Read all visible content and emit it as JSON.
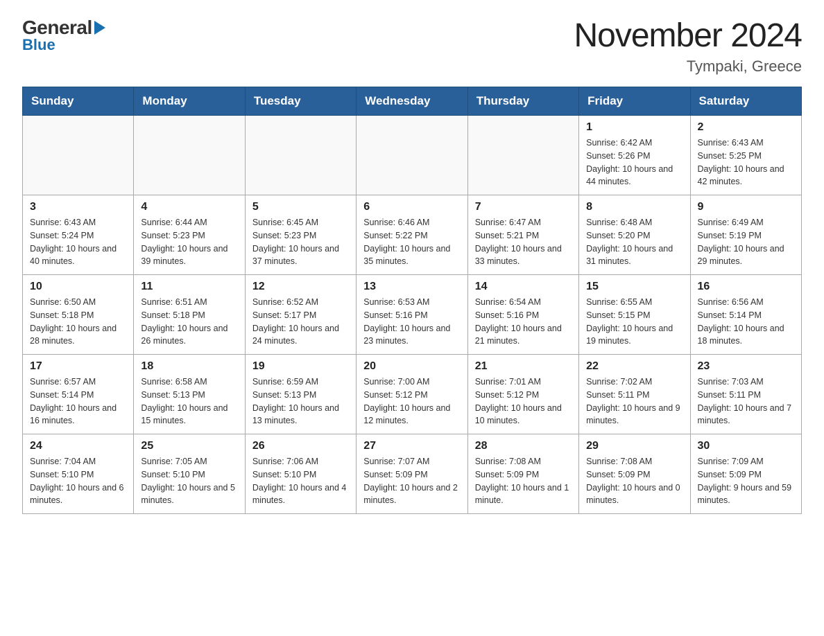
{
  "logo": {
    "general": "General",
    "blue": "Blue",
    "triangle_alt": "triangle"
  },
  "title": "November 2024",
  "subtitle": "Tympaki, Greece",
  "days_of_week": [
    "Sunday",
    "Monday",
    "Tuesday",
    "Wednesday",
    "Thursday",
    "Friday",
    "Saturday"
  ],
  "weeks": [
    [
      {
        "day": "",
        "info": ""
      },
      {
        "day": "",
        "info": ""
      },
      {
        "day": "",
        "info": ""
      },
      {
        "day": "",
        "info": ""
      },
      {
        "day": "",
        "info": ""
      },
      {
        "day": "1",
        "info": "Sunrise: 6:42 AM\nSunset: 5:26 PM\nDaylight: 10 hours and 44 minutes."
      },
      {
        "day": "2",
        "info": "Sunrise: 6:43 AM\nSunset: 5:25 PM\nDaylight: 10 hours and 42 minutes."
      }
    ],
    [
      {
        "day": "3",
        "info": "Sunrise: 6:43 AM\nSunset: 5:24 PM\nDaylight: 10 hours and 40 minutes."
      },
      {
        "day": "4",
        "info": "Sunrise: 6:44 AM\nSunset: 5:23 PM\nDaylight: 10 hours and 39 minutes."
      },
      {
        "day": "5",
        "info": "Sunrise: 6:45 AM\nSunset: 5:23 PM\nDaylight: 10 hours and 37 minutes."
      },
      {
        "day": "6",
        "info": "Sunrise: 6:46 AM\nSunset: 5:22 PM\nDaylight: 10 hours and 35 minutes."
      },
      {
        "day": "7",
        "info": "Sunrise: 6:47 AM\nSunset: 5:21 PM\nDaylight: 10 hours and 33 minutes."
      },
      {
        "day": "8",
        "info": "Sunrise: 6:48 AM\nSunset: 5:20 PM\nDaylight: 10 hours and 31 minutes."
      },
      {
        "day": "9",
        "info": "Sunrise: 6:49 AM\nSunset: 5:19 PM\nDaylight: 10 hours and 29 minutes."
      }
    ],
    [
      {
        "day": "10",
        "info": "Sunrise: 6:50 AM\nSunset: 5:18 PM\nDaylight: 10 hours and 28 minutes."
      },
      {
        "day": "11",
        "info": "Sunrise: 6:51 AM\nSunset: 5:18 PM\nDaylight: 10 hours and 26 minutes."
      },
      {
        "day": "12",
        "info": "Sunrise: 6:52 AM\nSunset: 5:17 PM\nDaylight: 10 hours and 24 minutes."
      },
      {
        "day": "13",
        "info": "Sunrise: 6:53 AM\nSunset: 5:16 PM\nDaylight: 10 hours and 23 minutes."
      },
      {
        "day": "14",
        "info": "Sunrise: 6:54 AM\nSunset: 5:16 PM\nDaylight: 10 hours and 21 minutes."
      },
      {
        "day": "15",
        "info": "Sunrise: 6:55 AM\nSunset: 5:15 PM\nDaylight: 10 hours and 19 minutes."
      },
      {
        "day": "16",
        "info": "Sunrise: 6:56 AM\nSunset: 5:14 PM\nDaylight: 10 hours and 18 minutes."
      }
    ],
    [
      {
        "day": "17",
        "info": "Sunrise: 6:57 AM\nSunset: 5:14 PM\nDaylight: 10 hours and 16 minutes."
      },
      {
        "day": "18",
        "info": "Sunrise: 6:58 AM\nSunset: 5:13 PM\nDaylight: 10 hours and 15 minutes."
      },
      {
        "day": "19",
        "info": "Sunrise: 6:59 AM\nSunset: 5:13 PM\nDaylight: 10 hours and 13 minutes."
      },
      {
        "day": "20",
        "info": "Sunrise: 7:00 AM\nSunset: 5:12 PM\nDaylight: 10 hours and 12 minutes."
      },
      {
        "day": "21",
        "info": "Sunrise: 7:01 AM\nSunset: 5:12 PM\nDaylight: 10 hours and 10 minutes."
      },
      {
        "day": "22",
        "info": "Sunrise: 7:02 AM\nSunset: 5:11 PM\nDaylight: 10 hours and 9 minutes."
      },
      {
        "day": "23",
        "info": "Sunrise: 7:03 AM\nSunset: 5:11 PM\nDaylight: 10 hours and 7 minutes."
      }
    ],
    [
      {
        "day": "24",
        "info": "Sunrise: 7:04 AM\nSunset: 5:10 PM\nDaylight: 10 hours and 6 minutes."
      },
      {
        "day": "25",
        "info": "Sunrise: 7:05 AM\nSunset: 5:10 PM\nDaylight: 10 hours and 5 minutes."
      },
      {
        "day": "26",
        "info": "Sunrise: 7:06 AM\nSunset: 5:10 PM\nDaylight: 10 hours and 4 minutes."
      },
      {
        "day": "27",
        "info": "Sunrise: 7:07 AM\nSunset: 5:09 PM\nDaylight: 10 hours and 2 minutes."
      },
      {
        "day": "28",
        "info": "Sunrise: 7:08 AM\nSunset: 5:09 PM\nDaylight: 10 hours and 1 minute."
      },
      {
        "day": "29",
        "info": "Sunrise: 7:08 AM\nSunset: 5:09 PM\nDaylight: 10 hours and 0 minutes."
      },
      {
        "day": "30",
        "info": "Sunrise: 7:09 AM\nSunset: 5:09 PM\nDaylight: 9 hours and 59 minutes."
      }
    ]
  ]
}
